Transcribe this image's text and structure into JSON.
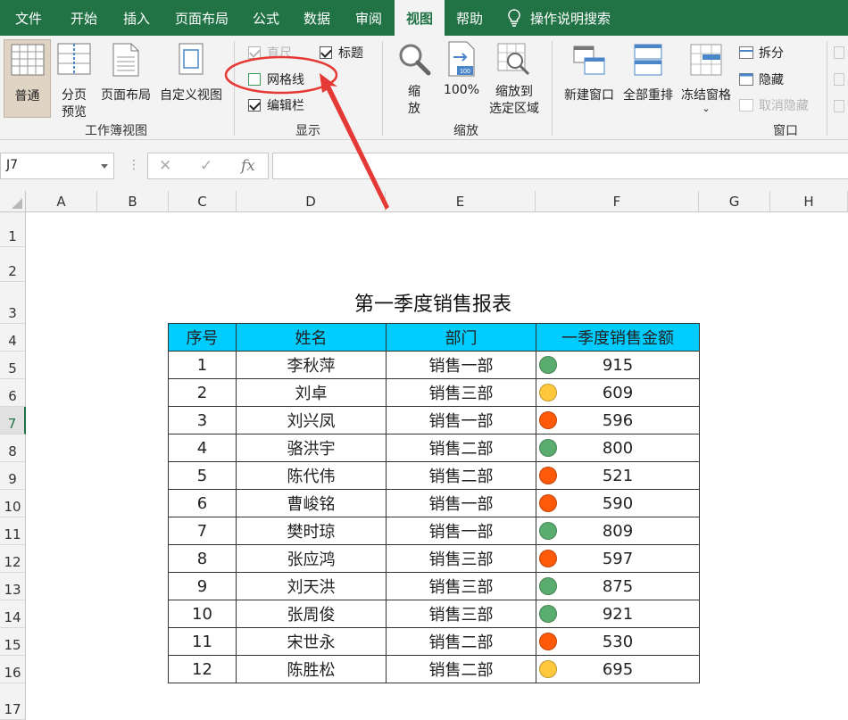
{
  "menu": {
    "items": [
      "文件",
      "开始",
      "插入",
      "页面布局",
      "公式",
      "数据",
      "审阅",
      "视图",
      "帮助"
    ],
    "active": "视图",
    "tell_me": "操作说明搜索"
  },
  "ribbon": {
    "workbook_views": {
      "normal": "普通",
      "page_break_line1": "分页",
      "page_break_line2": "预览",
      "page_layout": "页面布局",
      "custom_views": "自定义视图",
      "group_label": "工作簿视图"
    },
    "show": {
      "ruler": "直尺",
      "gridlines": "网格线",
      "formula_bar": "编辑栏",
      "headings": "标题",
      "group_label": "显示",
      "ruler_checked": true,
      "gridlines_checked": false,
      "formula_bar_checked": true,
      "headings_checked": true
    },
    "zoom": {
      "zoom_line1": "缩",
      "zoom_line2": "放",
      "zoom_100": "100%",
      "zoom_to_sel_line1": "缩放到",
      "zoom_to_sel_line2": "选定区域",
      "group_label": "缩放"
    },
    "window": {
      "new_window": "新建窗口",
      "arrange_all": "全部重排",
      "freeze_panes": "冻结窗格",
      "split": "拆分",
      "hide": "隐藏",
      "unhide": "取消隐藏",
      "group_label": "窗口"
    }
  },
  "formula_bar": {
    "name_box": "J7",
    "fx": "fx",
    "formula": ""
  },
  "sheet": {
    "columns": [
      "A",
      "B",
      "C",
      "D",
      "E",
      "F",
      "G",
      "H"
    ],
    "rows": [
      "1",
      "2",
      "3",
      "4",
      "5",
      "6",
      "7",
      "8",
      "9",
      "10",
      "11",
      "12",
      "13",
      "14",
      "15",
      "16",
      "17"
    ],
    "active_row": "7",
    "title": "第一季度销售报表",
    "headers": [
      "序号",
      "姓名",
      "部门",
      "一季度销售金额"
    ],
    "records": [
      {
        "no": "1",
        "name": "李秋萍",
        "dept": "销售一部",
        "amount": "915",
        "color": "#5aad6e"
      },
      {
        "no": "2",
        "name": "刘卓",
        "dept": "销售三部",
        "amount": "609",
        "color": "#ffc83d"
      },
      {
        "no": "3",
        "name": "刘兴凤",
        "dept": "销售一部",
        "amount": "596",
        "color": "#ff5a0a"
      },
      {
        "no": "4",
        "name": "骆洪宇",
        "dept": "销售二部",
        "amount": "800",
        "color": "#5aad6e"
      },
      {
        "no": "5",
        "name": "陈代伟",
        "dept": "销售二部",
        "amount": "521",
        "color": "#ff5a0a"
      },
      {
        "no": "6",
        "name": "曹峻铭",
        "dept": "销售一部",
        "amount": "590",
        "color": "#ff5a0a"
      },
      {
        "no": "7",
        "name": "樊时琼",
        "dept": "销售一部",
        "amount": "809",
        "color": "#5aad6e"
      },
      {
        "no": "8",
        "name": "张应鸿",
        "dept": "销售三部",
        "amount": "597",
        "color": "#ff5a0a"
      },
      {
        "no": "9",
        "name": "刘天洪",
        "dept": "销售三部",
        "amount": "875",
        "color": "#5aad6e"
      },
      {
        "no": "10",
        "name": "张周俊",
        "dept": "销售三部",
        "amount": "921",
        "color": "#5aad6e"
      },
      {
        "no": "11",
        "name": "宋世永",
        "dept": "销售二部",
        "amount": "530",
        "color": "#ff5a0a"
      },
      {
        "no": "12",
        "name": "陈胜松",
        "dept": "销售二部",
        "amount": "695",
        "color": "#ffc83d"
      }
    ]
  },
  "colors": {
    "accent": "#217346",
    "header_fill": "#00ccff",
    "annotation": "#e53935"
  }
}
